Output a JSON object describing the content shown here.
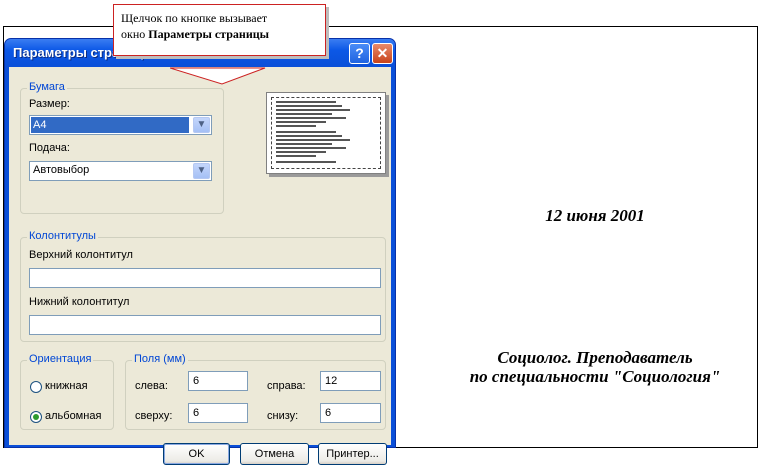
{
  "callout": {
    "line1": "Щелчок по кнопке вызывает",
    "line2_prefix": "окно ",
    "line2_bold": "Параметры страницы"
  },
  "document": {
    "date": "12 июня 2001",
    "signature_line1": "Социолог. Преподаватель",
    "signature_line2": "по специальности \"Социология\""
  },
  "dialog": {
    "title": "Параметры страницы",
    "help_label": "?",
    "close_label": "✕",
    "paper": {
      "legend": "Бумага",
      "size_label": "Размер:",
      "size_value": "A4",
      "source_label": "Подача:",
      "source_value": "Автовыбор"
    },
    "headers": {
      "legend": "Колонтитулы",
      "header_label": "Верхний колонтитул",
      "header_value": "",
      "footer_label": "Нижний колонтитул",
      "footer_value": ""
    },
    "orientation": {
      "legend": "Ориентация",
      "portrait": "книжная",
      "landscape": "альбомная",
      "selected": "landscape"
    },
    "margins": {
      "legend": "Поля (мм)",
      "left_label": "слева:",
      "left_value": "6",
      "right_label": "справа:",
      "right_value": "12",
      "top_label": "сверху:",
      "top_value": "6",
      "bottom_label": "снизу:",
      "bottom_value": "6"
    },
    "buttons": {
      "ok": "OK",
      "cancel": "Отмена",
      "printer": "Принтер..."
    },
    "icons": {
      "dropdown": "chevron-down-icon",
      "help": "help-icon",
      "close": "close-icon"
    }
  }
}
